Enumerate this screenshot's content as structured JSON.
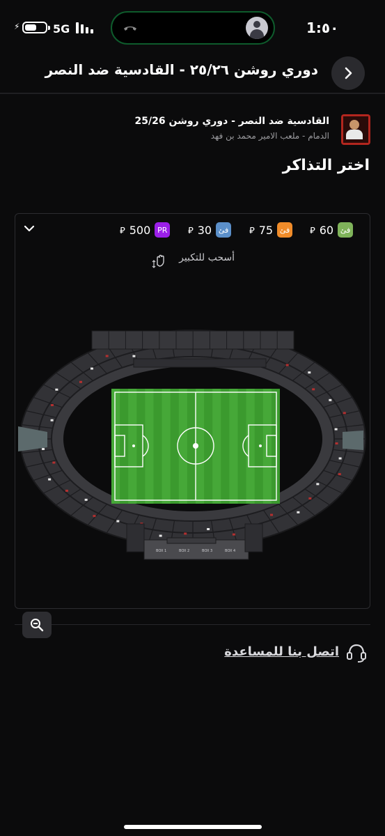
{
  "status_bar": {
    "time": "1:٥٠",
    "network": "5G"
  },
  "header": {
    "title": "دوري روشن ٢٥/٢٦ - القادسية ضد النصر"
  },
  "event": {
    "title": "القادسية ضد النصر - دوري روشن 25/26",
    "venue": "الدمام - ملعب الامير محمد بن فهد"
  },
  "section_title": "اختر التذاكر",
  "legend": [
    {
      "badge": "PR",
      "price": "500",
      "color": "#9b1fe8"
    },
    {
      "badge": "فئ",
      "price": "30",
      "color": "#5b8fc9"
    },
    {
      "badge": "فئ",
      "price": "75",
      "color": "#f08c2a"
    },
    {
      "badge": "فئ",
      "price": "60",
      "color": "#7fb35a"
    }
  ],
  "currency_symbol": "⃁",
  "zoom_hint": "أسحب للتكبير",
  "box_labels": [
    "BOX 1",
    "BOX 2",
    "BOX 3",
    "BOX 4"
  ],
  "help_link": "اتصل بنا للمساعدة",
  "icons": {
    "back": "chevron-right-icon",
    "collapse": "chevron-down-icon",
    "zoom_out": "zoom-out-icon",
    "help": "headset-icon",
    "hint": "pinch-zoom-icon"
  }
}
